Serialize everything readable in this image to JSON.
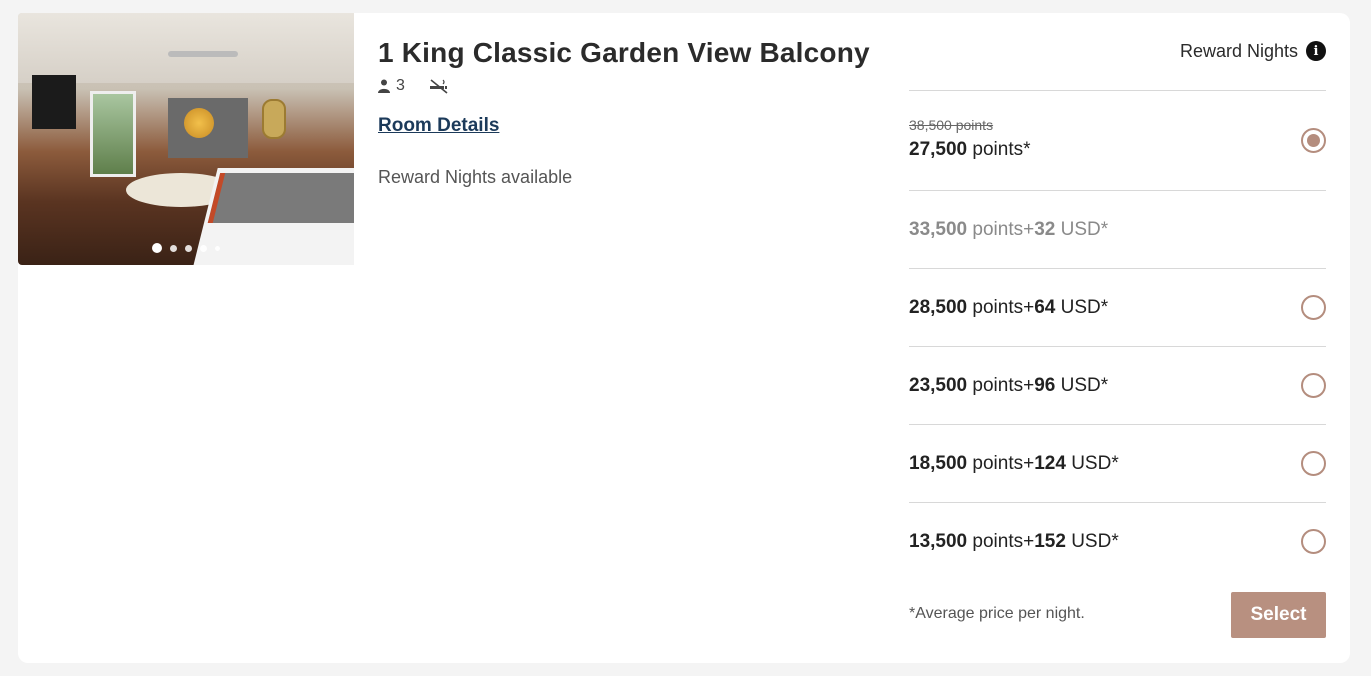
{
  "room": {
    "title": "1 King Classic Garden View Balcony",
    "occupancy": "3",
    "details_link": "Room Details",
    "availability": "Reward Nights available",
    "image_dots": 5,
    "active_dot": 1
  },
  "rates": {
    "header": "Reward Nights",
    "options": [
      {
        "original": "38,500 points",
        "points": "27,500",
        "points_label": "points*",
        "cash": "",
        "cash_label": "",
        "selected": true,
        "disabled": false
      },
      {
        "points": "33,500",
        "points_label": "points",
        "plus": "+",
        "cash": "32",
        "cash_label": "USD*",
        "selected": false,
        "disabled": true
      },
      {
        "points": "28,500",
        "points_label": "points",
        "plus": "+",
        "cash": "64",
        "cash_label": "USD*",
        "selected": false,
        "disabled": false
      },
      {
        "points": "23,500",
        "points_label": "points",
        "plus": "+",
        "cash": "96",
        "cash_label": "USD*",
        "selected": false,
        "disabled": false
      },
      {
        "points": "18,500",
        "points_label": "points",
        "plus": "+",
        "cash": "124",
        "cash_label": "USD*",
        "selected": false,
        "disabled": false
      },
      {
        "points": "13,500",
        "points_label": "points",
        "plus": "+",
        "cash": "152",
        "cash_label": "USD*",
        "selected": false,
        "disabled": false
      }
    ],
    "footnote": "*Average price per night.",
    "select_label": "Select"
  },
  "colors": {
    "accent": "#b89080",
    "link": "#1c3a5a"
  }
}
